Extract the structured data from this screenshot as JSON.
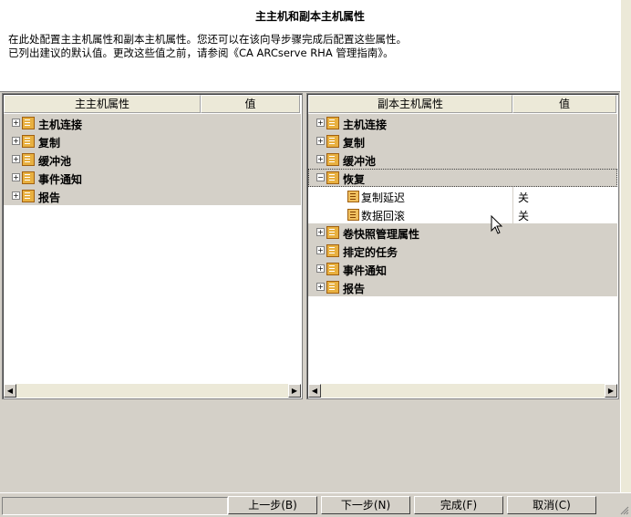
{
  "header": {
    "title": "主主机和副本主机属性",
    "line1": "在此处配置主主机属性和副本主机属性。您还可以在该向导步骤完成后配置这些属性。",
    "line2": "已列出建议的默认值。更改这些值之前，请参阅《CA ARCserve RHA 管理指南》。"
  },
  "left_pane": {
    "col_name": "主主机属性",
    "col_value": "值",
    "items": [
      {
        "label": "主机连接"
      },
      {
        "label": "复制"
      },
      {
        "label": "缓冲池"
      },
      {
        "label": "事件通知"
      },
      {
        "label": "报告"
      }
    ]
  },
  "right_pane": {
    "col_name": "副本主机属性",
    "col_value": "值",
    "items": [
      {
        "label": "主机连接"
      },
      {
        "label": "复制"
      },
      {
        "label": "缓冲池"
      },
      {
        "label": "恢复"
      },
      {
        "label": "卷快照管理属性"
      },
      {
        "label": "排定的任务"
      },
      {
        "label": "事件通知"
      },
      {
        "label": "报告"
      }
    ],
    "recovery_children": [
      {
        "label": "复制延迟",
        "value": "关"
      },
      {
        "label": "数据回滚",
        "value": "关"
      }
    ]
  },
  "expander": {
    "collapsed": "+",
    "expanded": "−"
  },
  "footer": {
    "back": "上一步(B)",
    "next": "下一步(N)",
    "finish": "完成(F)",
    "cancel": "取消(C)"
  },
  "scroll": {
    "left_arrow": "◀",
    "right_arrow": "▶"
  }
}
